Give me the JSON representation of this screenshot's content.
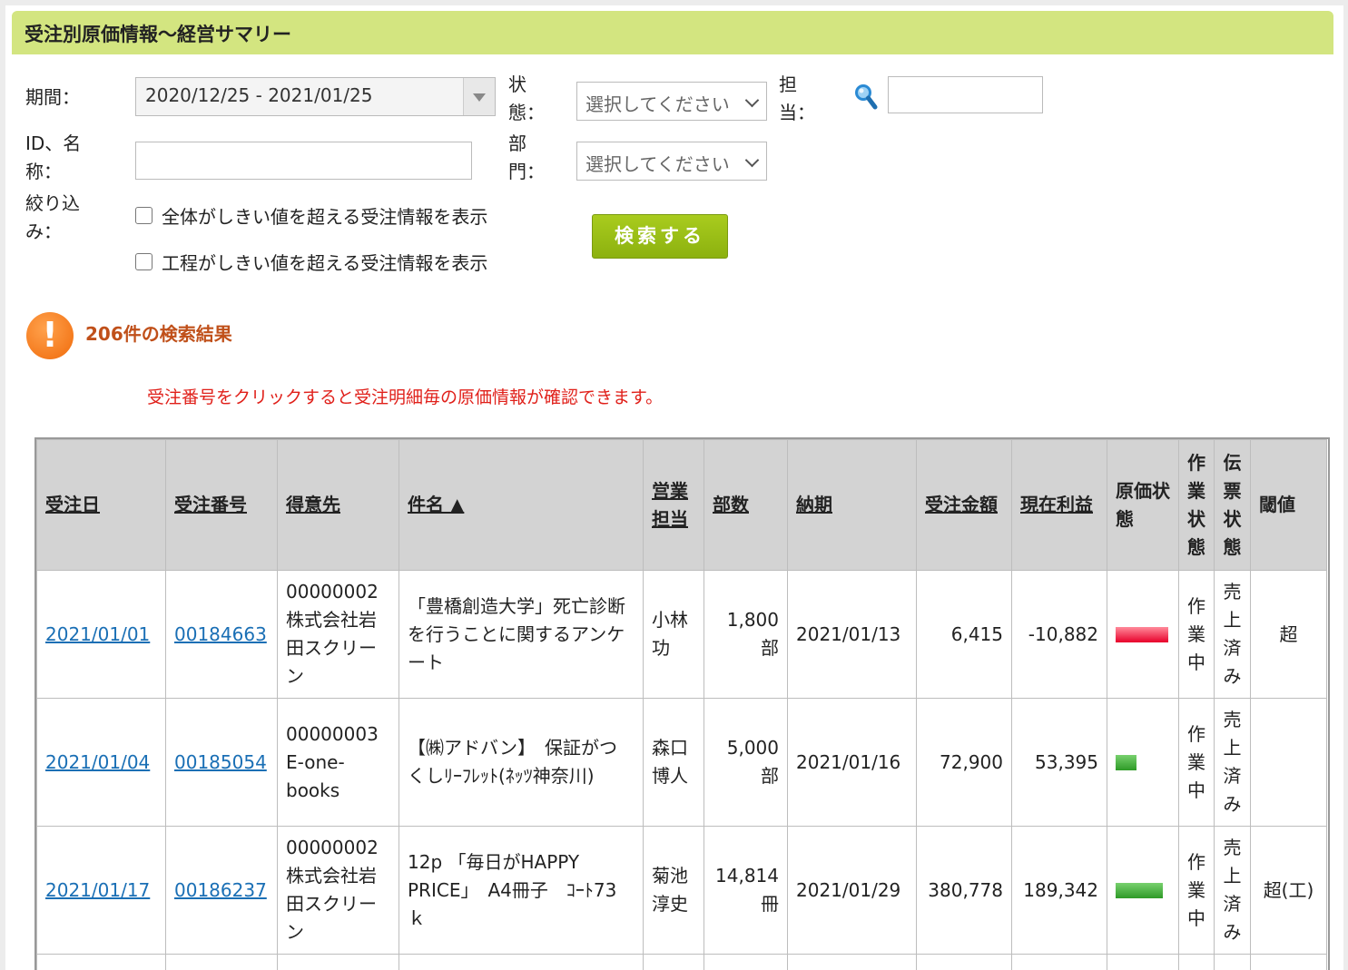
{
  "page_title": "受注別原価情報～経営サマリー",
  "filters": {
    "period_label": "期間：",
    "period_value": "2020/12/25 - 2021/01/25",
    "status_label": "状態：",
    "status_placeholder": "選択してください",
    "assignee_label": "担当：",
    "assignee_value": "",
    "id_name_label": "ID、名称：",
    "id_name_value": "",
    "department_label": "部門：",
    "department_placeholder": "選択してください",
    "narrow_label": "絞り込み：",
    "checkbox_overall": "全体がしきい値を超える受注情報を表示",
    "checkbox_process": "工程がしきい値を超える受注情報を表示",
    "search_button": "検索する"
  },
  "results": {
    "count_text": "206件の検索結果",
    "notice": "受注番号をクリックすると受注明細毎の原価情報が確認できます。"
  },
  "table": {
    "headers": [
      "受注日",
      "受注番号",
      "得意先",
      "件名 ▲",
      "営業担当",
      "部数",
      "納期",
      "受注金額",
      "現在利益",
      "原価状態",
      "作業状態",
      "伝票状態",
      "閾値"
    ],
    "rows": [
      {
        "order_date": "2021/01/01",
        "order_no": "00184663",
        "customer": "00000002 株式会社岩田スクリーン",
        "subject": "「豊橋創造大学」死亡診断を行うことに関するアンケート",
        "sales": "小林功",
        "copies": "1,800部",
        "due": "2021/01/13",
        "amount": "6,415",
        "profit": "-10,882",
        "cost_status": "red",
        "cost_level": -1.0,
        "work_status": "作業中",
        "slip_status": "売上済み",
        "threshold": "超"
      },
      {
        "order_date": "2021/01/04",
        "order_no": "00185054",
        "customer": "00000003 E-one-books",
        "subject": "【㈱アドバン】　保証がつくしﾘｰﾌﾚｯﾄ(ﾈｯﾂ神奈川)",
        "sales": "森口博人",
        "copies": "5,000部",
        "due": "2021/01/16",
        "amount": "72,900",
        "profit": "53,395",
        "cost_status": "green",
        "cost_level": 0.4,
        "work_status": "作業中",
        "slip_status": "売上済み",
        "threshold": ""
      },
      {
        "order_date": "2021/01/17",
        "order_no": "00186237",
        "customer": "00000002 株式会社岩田スクリーン",
        "subject": "12p 「毎日がHAPPY PRICE」　A4冊子　ｺｰﾄ73ｋ",
        "sales": "菊池淳史",
        "copies": "14,814冊",
        "due": "2021/01/29",
        "amount": "380,778",
        "profit": "189,342",
        "cost_status": "green",
        "cost_level": 0.9,
        "work_status": "作業中",
        "slip_status": "売上済み",
        "threshold": "超(工)"
      }
    ]
  },
  "colors": {
    "title_bar": "#d3e580",
    "link": "#1a6fb5",
    "notice": "#e0201a",
    "result_count": "#c0501a",
    "search_button": "#9cbf17"
  },
  "icons": {
    "search": "magnifier-icon",
    "alert": "exclamation-icon"
  }
}
